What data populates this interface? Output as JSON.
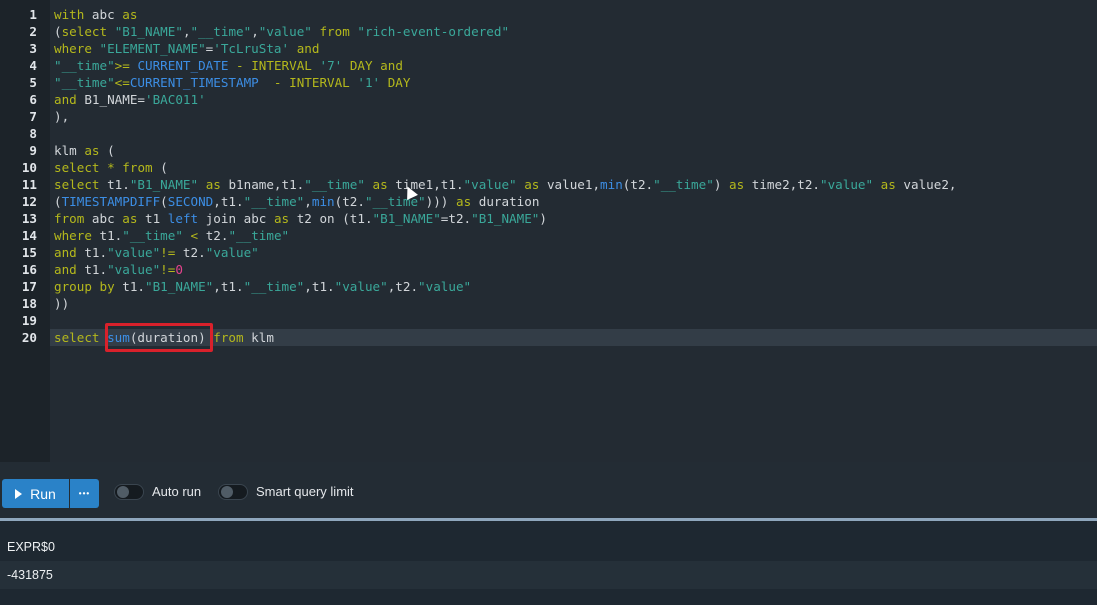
{
  "editor": {
    "line_numbers": [
      "1",
      "2",
      "3",
      "4",
      "5",
      "6",
      "7",
      "8",
      "9",
      "10",
      "11",
      "12",
      "13",
      "14",
      "15",
      "16",
      "17",
      "18",
      "19",
      "20"
    ],
    "lines": [
      [
        {
          "c": "k",
          "t": "with"
        },
        {
          "c": "t",
          "t": " abc "
        },
        {
          "c": "k",
          "t": "as"
        }
      ],
      [
        {
          "c": "t",
          "t": "("
        },
        {
          "c": "k",
          "t": "select"
        },
        {
          "c": "t",
          "t": " "
        },
        {
          "c": "s",
          "t": "\"B1_NAME\""
        },
        {
          "c": "t",
          "t": ","
        },
        {
          "c": "s",
          "t": "\"__time\""
        },
        {
          "c": "t",
          "t": ","
        },
        {
          "c": "s",
          "t": "\"value\""
        },
        {
          "c": "t",
          "t": " "
        },
        {
          "c": "k",
          "t": "from"
        },
        {
          "c": "t",
          "t": " "
        },
        {
          "c": "s",
          "t": "\"rich-event-ordered\""
        }
      ],
      [
        {
          "c": "k",
          "t": "where"
        },
        {
          "c": "t",
          "t": " "
        },
        {
          "c": "s",
          "t": "\"ELEMENT_NAME\""
        },
        {
          "c": "t",
          "t": "="
        },
        {
          "c": "s",
          "t": "'TcLruSta'"
        },
        {
          "c": "t",
          "t": " "
        },
        {
          "c": "k",
          "t": "and"
        }
      ],
      [
        {
          "c": "s",
          "t": "\"__time\""
        },
        {
          "c": "k",
          "t": ">="
        },
        {
          "c": "t",
          "t": " "
        },
        {
          "c": "f",
          "t": "CURRENT_DATE"
        },
        {
          "c": "t",
          "t": " "
        },
        {
          "c": "k",
          "t": "-"
        },
        {
          "c": "t",
          "t": " "
        },
        {
          "c": "k",
          "t": "INTERVAL"
        },
        {
          "c": "t",
          "t": " "
        },
        {
          "c": "s",
          "t": "'7'"
        },
        {
          "c": "t",
          "t": " "
        },
        {
          "c": "k",
          "t": "DAY"
        },
        {
          "c": "t",
          "t": " "
        },
        {
          "c": "k",
          "t": "and"
        }
      ],
      [
        {
          "c": "s",
          "t": "\"__time\""
        },
        {
          "c": "k",
          "t": "<="
        },
        {
          "c": "f",
          "t": "CURRENT_TIMESTAMP"
        },
        {
          "c": "t",
          "t": "  "
        },
        {
          "c": "k",
          "t": "-"
        },
        {
          "c": "t",
          "t": " "
        },
        {
          "c": "k",
          "t": "INTERVAL"
        },
        {
          "c": "t",
          "t": " "
        },
        {
          "c": "s",
          "t": "'1'"
        },
        {
          "c": "t",
          "t": " "
        },
        {
          "c": "k",
          "t": "DAY"
        }
      ],
      [
        {
          "c": "k",
          "t": "and"
        },
        {
          "c": "t",
          "t": " B1_NAME="
        },
        {
          "c": "s",
          "t": "'BAC011'"
        }
      ],
      [
        {
          "c": "t",
          "t": "),"
        }
      ],
      [],
      [
        {
          "c": "t",
          "t": "klm "
        },
        {
          "c": "k",
          "t": "as"
        },
        {
          "c": "t",
          "t": " ("
        }
      ],
      [
        {
          "c": "k",
          "t": "select"
        },
        {
          "c": "t",
          "t": " "
        },
        {
          "c": "k",
          "t": "*"
        },
        {
          "c": "t",
          "t": " "
        },
        {
          "c": "k",
          "t": "from"
        },
        {
          "c": "t",
          "t": " ("
        }
      ],
      [
        {
          "c": "k",
          "t": "select"
        },
        {
          "c": "t",
          "t": " t1."
        },
        {
          "c": "s",
          "t": "\"B1_NAME\""
        },
        {
          "c": "t",
          "t": " "
        },
        {
          "c": "k",
          "t": "as"
        },
        {
          "c": "t",
          "t": " b1name,t1."
        },
        {
          "c": "s",
          "t": "\"__time\""
        },
        {
          "c": "t",
          "t": " "
        },
        {
          "c": "k",
          "t": "as"
        },
        {
          "c": "t",
          "t": " time1,t1."
        },
        {
          "c": "s",
          "t": "\"value\""
        },
        {
          "c": "t",
          "t": " "
        },
        {
          "c": "k",
          "t": "as"
        },
        {
          "c": "t",
          "t": " value1,"
        },
        {
          "c": "f",
          "t": "min"
        },
        {
          "c": "t",
          "t": "(t2."
        },
        {
          "c": "s",
          "t": "\"__time\""
        },
        {
          "c": "t",
          "t": ") "
        },
        {
          "c": "k",
          "t": "as"
        },
        {
          "c": "t",
          "t": " time2,t2."
        },
        {
          "c": "s",
          "t": "\"value\""
        },
        {
          "c": "t",
          "t": " "
        },
        {
          "c": "k",
          "t": "as"
        },
        {
          "c": "t",
          "t": " value2,"
        }
      ],
      [
        {
          "c": "t",
          "t": "("
        },
        {
          "c": "f",
          "t": "TIMESTAMPDIFF"
        },
        {
          "c": "t",
          "t": "("
        },
        {
          "c": "f",
          "t": "SECOND"
        },
        {
          "c": "t",
          "t": ",t1."
        },
        {
          "c": "s",
          "t": "\"__time\""
        },
        {
          "c": "t",
          "t": ","
        },
        {
          "c": "f",
          "t": "min"
        },
        {
          "c": "t",
          "t": "(t2."
        },
        {
          "c": "s",
          "t": "\"__time\""
        },
        {
          "c": "t",
          "t": "))) "
        },
        {
          "c": "k",
          "t": "as"
        },
        {
          "c": "t",
          "t": " duration"
        }
      ],
      [
        {
          "c": "k",
          "t": "from"
        },
        {
          "c": "t",
          "t": " abc "
        },
        {
          "c": "k",
          "t": "as"
        },
        {
          "c": "t",
          "t": " t1 "
        },
        {
          "c": "f",
          "t": "left"
        },
        {
          "c": "t",
          "t": " join abc "
        },
        {
          "c": "k",
          "t": "as"
        },
        {
          "c": "t",
          "t": " t2 on (t1."
        },
        {
          "c": "s",
          "t": "\"B1_NAME\""
        },
        {
          "c": "t",
          "t": "=t2."
        },
        {
          "c": "s",
          "t": "\"B1_NAME\""
        },
        {
          "c": "t",
          "t": ")"
        }
      ],
      [
        {
          "c": "k",
          "t": "where"
        },
        {
          "c": "t",
          "t": " t1."
        },
        {
          "c": "s",
          "t": "\"__time\""
        },
        {
          "c": "t",
          "t": " "
        },
        {
          "c": "k",
          "t": "<"
        },
        {
          "c": "t",
          "t": " t2."
        },
        {
          "c": "s",
          "t": "\"__time\""
        }
      ],
      [
        {
          "c": "k",
          "t": "and"
        },
        {
          "c": "t",
          "t": " t1."
        },
        {
          "c": "s",
          "t": "\"value\""
        },
        {
          "c": "k",
          "t": "!="
        },
        {
          "c": "t",
          "t": " t2."
        },
        {
          "c": "s",
          "t": "\"value\""
        }
      ],
      [
        {
          "c": "k",
          "t": "and"
        },
        {
          "c": "t",
          "t": " t1."
        },
        {
          "c": "s",
          "t": "\"value\""
        },
        {
          "c": "k",
          "t": "!="
        },
        {
          "c": "n",
          "t": "0"
        }
      ],
      [
        {
          "c": "k",
          "t": "group by"
        },
        {
          "c": "t",
          "t": " t1."
        },
        {
          "c": "s",
          "t": "\"B1_NAME\""
        },
        {
          "c": "t",
          "t": ",t1."
        },
        {
          "c": "s",
          "t": "\"__time\""
        },
        {
          "c": "t",
          "t": ",t1."
        },
        {
          "c": "s",
          "t": "\"value\""
        },
        {
          "c": "t",
          "t": ",t2."
        },
        {
          "c": "s",
          "t": "\"value\""
        }
      ],
      [
        {
          "c": "t",
          "t": "))"
        }
      ],
      [],
      [
        {
          "c": "k",
          "t": "select"
        },
        {
          "c": "t",
          "t": " "
        },
        {
          "c": "f",
          "t": "sum"
        },
        {
          "c": "t",
          "t": "(duration) "
        },
        {
          "c": "k",
          "t": "from"
        },
        {
          "c": "t",
          "t": " klm"
        }
      ]
    ]
  },
  "toolbar": {
    "run_label": "Run",
    "more_label": "•••",
    "auto_run_label": "Auto run",
    "smart_limit_label": "Smart query limit",
    "auto_run_on": false,
    "smart_limit_on": false
  },
  "results": {
    "column_header": "EXPR$0",
    "value": "-431875"
  },
  "colors": {
    "keyword": "#b4b81c",
    "string": "#3aa89a",
    "function": "#3c8ee5",
    "accent_run": "#2a82c8",
    "highlight_box": "#d9212b"
  },
  "icons": [
    "play-icon",
    "more-options-icon",
    "mouse-cursor-icon"
  ]
}
